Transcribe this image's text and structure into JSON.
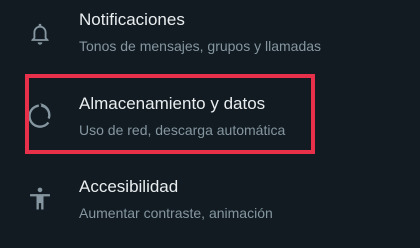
{
  "settings": {
    "items": [
      {
        "title": "Notificaciones",
        "subtitle": "Tonos de mensajes, grupos y llamadas",
        "icon": "bell-icon"
      },
      {
        "title": "Almacenamiento y datos",
        "subtitle": "Uso de red, descarga automática",
        "icon": "data-usage-icon"
      },
      {
        "title": "Accesibilidad",
        "subtitle": "Aumentar contraste, animación",
        "icon": "accessibility-icon"
      }
    ]
  },
  "colors": {
    "background": "#111b21",
    "title_text": "#e9edef",
    "subtitle_text": "#8696a0",
    "icon": "#8696a0",
    "highlight_border": "#e8304a"
  }
}
